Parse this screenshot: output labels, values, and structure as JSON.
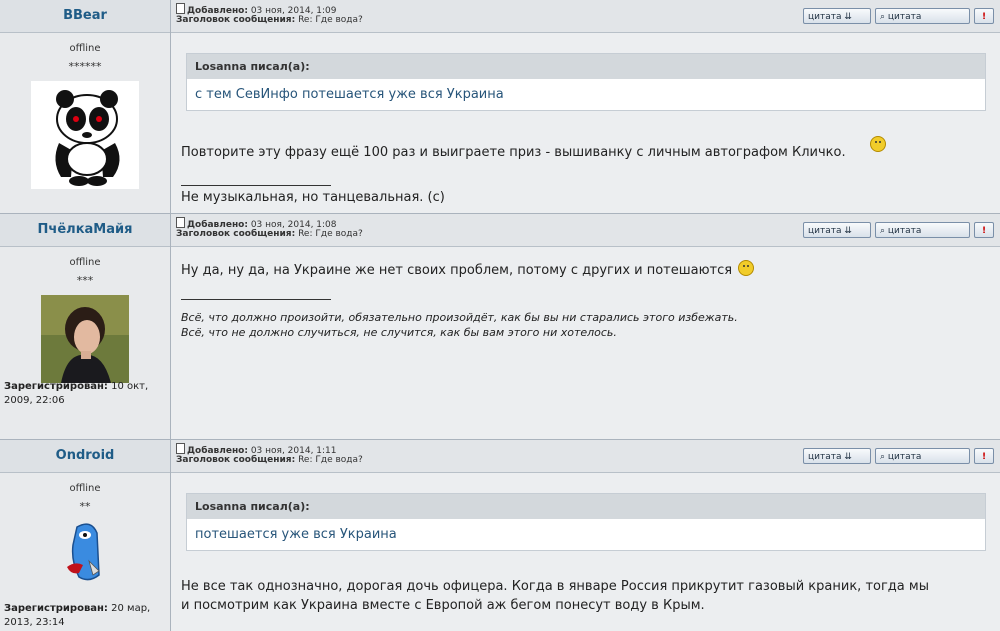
{
  "posts": [
    {
      "username": "BBear",
      "status": "offline",
      "rank_stars": "******",
      "added_label": "Добавлено:",
      "added_value": "03 ноя, 2014, 1:09",
      "subject_label": "Заголовок сообщения:",
      "subject_value": "Re: Где вода?",
      "buttons": {
        "quote": "цитата",
        "quote2": "цитата",
        "report": "!"
      },
      "quote_header": "Losanna писал(а):",
      "quote_text": "с тем СевИнфо потешается уже вся Украина",
      "message": "Повторите эту фразу ещё 100 раз и выиграете приз - вышиванку с личным автографом Кличко.",
      "signature": "Не музыкальная, но танцевальная. (с)"
    },
    {
      "username": "ПчёлкаМайя",
      "status": "offline",
      "rank_stars": "***",
      "added_label": "Добавлено:",
      "added_value": "03 ноя, 2014, 1:08",
      "subject_label": "Заголовок сообщения:",
      "subject_value": "Re: Где вода?",
      "buttons": {
        "quote": "цитата",
        "quote2": "цитата",
        "report": "!"
      },
      "message": "Ну да, ну да, на Украине же нет своих проблем, потому с других и потешаются",
      "signature_line1": "Всё, что должно произойти, обязательно произойдёт, как бы вы ни старались этого избежать.",
      "signature_line2": "Всё, что не должно случиться, не случится, как бы вам этого ни хотелось.",
      "registered_label": "Зарегистрирован:",
      "registered_value": "10 окт, 2009, 22:06"
    },
    {
      "username": "Ondroid",
      "status": "offline",
      "rank_stars": "**",
      "added_label": "Добавлено:",
      "added_value": "03 ноя, 2014, 1:11",
      "subject_label": "Заголовок сообщения:",
      "subject_value": "Re: Где вода?",
      "buttons": {
        "quote": "цитата",
        "quote2": "цитата",
        "report": "!"
      },
      "quote_header": "Losanna писал(а):",
      "quote_text": "потешается уже вся Украина",
      "message_line1": "Не все так однозначно, дорогая дочь офицера. Когда в январе Россия прикрутит газовый краник, тогда мы",
      "message_line2": "и посмотрим как Украина вместе с Европой аж бегом понесут воду в Крым.",
      "registered_label": "Зарегистрирован:",
      "registered_value": "20 мар, 2013, 23:14"
    }
  ]
}
